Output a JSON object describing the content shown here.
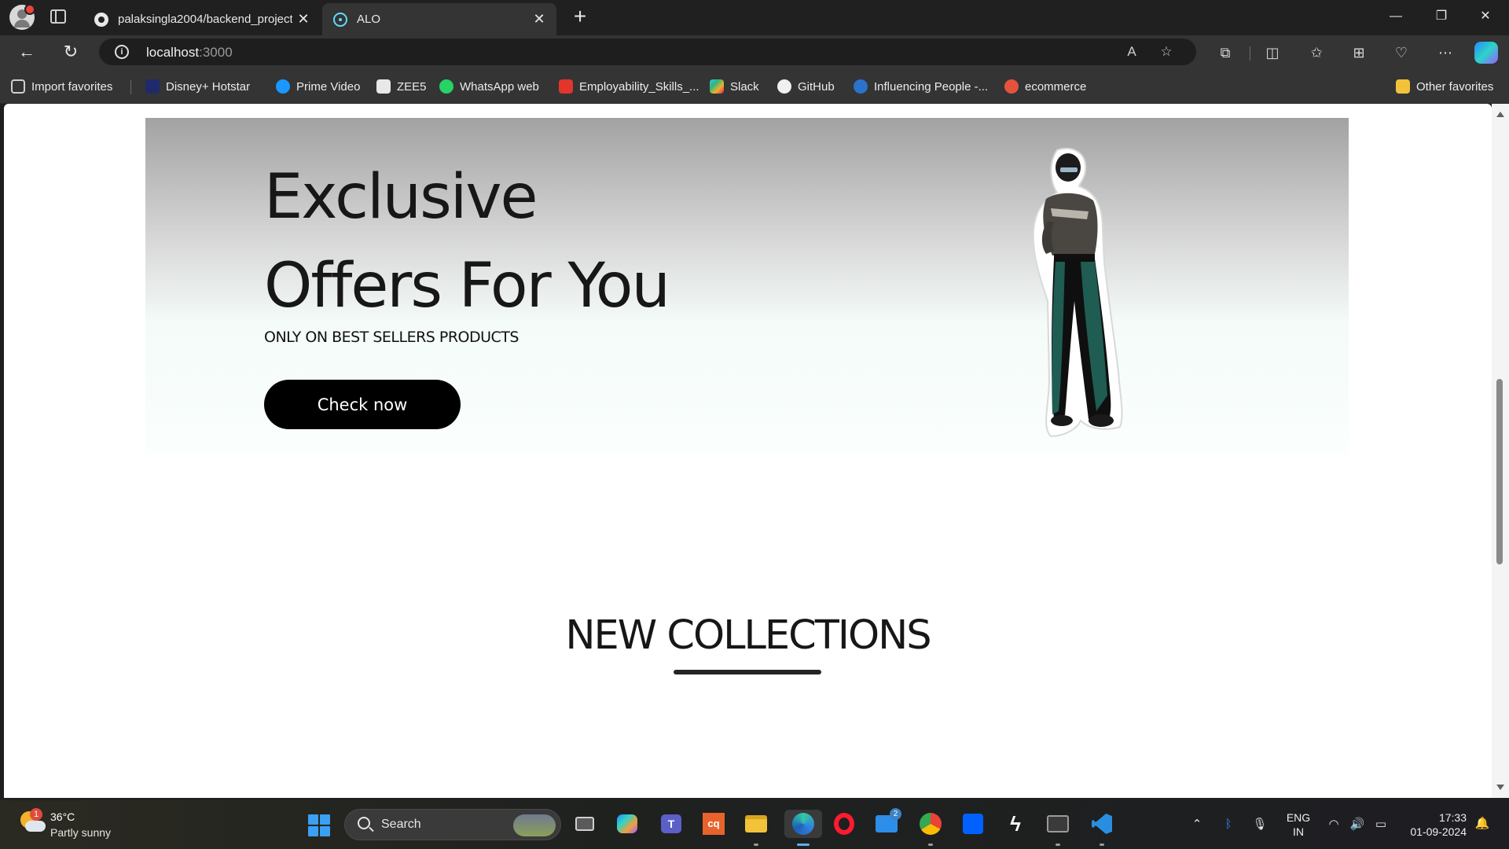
{
  "browser": {
    "tabs": [
      {
        "title": "palaksingla2004/backend_project",
        "close": "✕",
        "favicon": "github-icon"
      },
      {
        "title": "ALO",
        "close": "✕",
        "favicon": "react-icon"
      }
    ],
    "new_tab": "+",
    "window_controls": {
      "minimize": "—",
      "maximize": "❐",
      "close": "✕"
    },
    "url_host": "localhost",
    "url_port": ":3000",
    "favorites": [
      {
        "label": "Import favorites",
        "icon": "import-icon",
        "color": "#cfcfcf"
      },
      {
        "label": "Disney+ Hotstar",
        "icon": "hotstar-icon",
        "color": "#1f2a6b"
      },
      {
        "label": "Prime Video",
        "icon": "prime-video-icon",
        "color": "#1a98ff"
      },
      {
        "label": "ZEE5",
        "icon": "zee5-icon",
        "color": "#e8e8e8"
      },
      {
        "label": "WhatsApp web",
        "icon": "whatsapp-icon",
        "color": "#25d366"
      },
      {
        "label": "Employability_Skills_...",
        "icon": "pdf-icon",
        "color": "#e2352b"
      },
      {
        "label": "Slack",
        "icon": "slack-icon",
        "color": "#e01e5a"
      },
      {
        "label": "GitHub",
        "icon": "github-icon",
        "color": "#f0f0f0"
      },
      {
        "label": "Influencing People -...",
        "icon": "coursera-icon",
        "color": "#2a73cc"
      },
      {
        "label": "ecommerce",
        "icon": "ecommerce-icon",
        "color": "#e5533d"
      }
    ],
    "other_favorites": "Other favorites"
  },
  "page": {
    "hero": {
      "title_line1": "Exclusive",
      "title_line2": "Offers For You",
      "subtitle": "ONLY ON BEST SELLERS PRODUCTS",
      "cta": "Check now"
    },
    "section_title": "NEW COLLECTIONS"
  },
  "taskbar": {
    "weather_badge": "1",
    "temperature": "36°C",
    "weather": "Partly sunny",
    "search_label": "Search",
    "mail_badge": "2",
    "lang_line1": "ENG",
    "lang_line2": "IN",
    "time": "17:33",
    "date": "01-09-2024"
  },
  "colors": {
    "cta_background": "#000000",
    "accent_scroll": "#8a8a8a"
  }
}
